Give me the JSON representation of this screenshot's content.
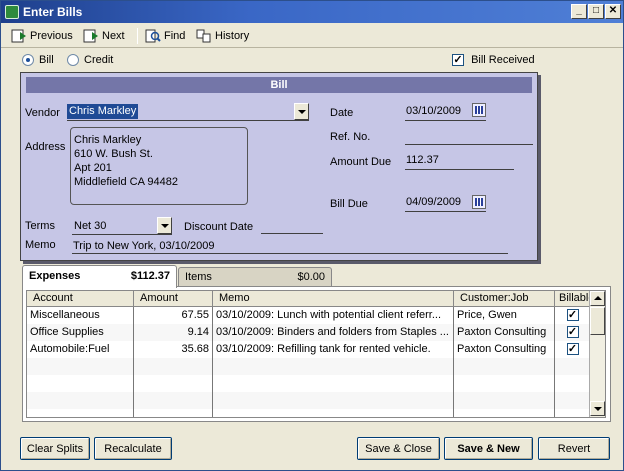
{
  "window": {
    "title": "Enter Bills"
  },
  "toolbar": {
    "previous": "Previous",
    "next": "Next",
    "find": "Find",
    "history": "History"
  },
  "bill_type": {
    "bill": "Bill",
    "credit": "Credit",
    "selected": "bill"
  },
  "bill_received": {
    "label": "Bill Received",
    "checked": true
  },
  "form": {
    "header": "Bill",
    "vendor_label": "Vendor",
    "vendor": "Chris Markley",
    "address_label": "Address",
    "address_lines": [
      "Chris Markley",
      "610 W. Bush St.",
      "Apt 201",
      "Middlefield CA 94482"
    ],
    "date_label": "Date",
    "date": "03/10/2009",
    "ref_label": "Ref. No.",
    "ref_no": "",
    "amount_due_label": "Amount Due",
    "amount_due": "112.37",
    "bill_due_label": "Bill Due",
    "bill_due": "04/09/2009",
    "terms_label": "Terms",
    "terms": "Net 30",
    "discount_label": "Discount Date",
    "discount_date": "",
    "memo_label": "Memo",
    "memo": "Trip to New York, 03/10/2009"
  },
  "tabs": [
    {
      "label": "Expenses",
      "amount": "$112.37"
    },
    {
      "label": "Items",
      "amount": "$0.00"
    }
  ],
  "expenses": {
    "columns": [
      "Account",
      "Amount",
      "Memo",
      "Customer:Job",
      "Billable?"
    ],
    "rows": [
      {
        "account": "Miscellaneous",
        "amount": "67.55",
        "memo": "03/10/2009: Lunch with potential client referr...",
        "customer": "Price,  Gwen",
        "billable": true
      },
      {
        "account": "Office Supplies",
        "amount": "9.14",
        "memo": "03/10/2009: Binders and folders from Staples ...",
        "customer": "Paxton Consulting",
        "billable": true
      },
      {
        "account": "Automobile:Fuel",
        "amount": "35.68",
        "memo": "03/10/2009: Refilling tank for rented vehicle.",
        "customer": "Paxton Consulting",
        "billable": true
      }
    ]
  },
  "buttons": {
    "clear_splits": "Clear Splits",
    "recalculate": "Recalculate",
    "save_close": "Save & Close",
    "save_new": "Save & New",
    "revert": "Revert"
  },
  "colors": {
    "title_bar": "#1e3f8c",
    "form_bg": "#c6c6e6",
    "form_header": "#7476a8",
    "selection": "#1f4a95"
  }
}
